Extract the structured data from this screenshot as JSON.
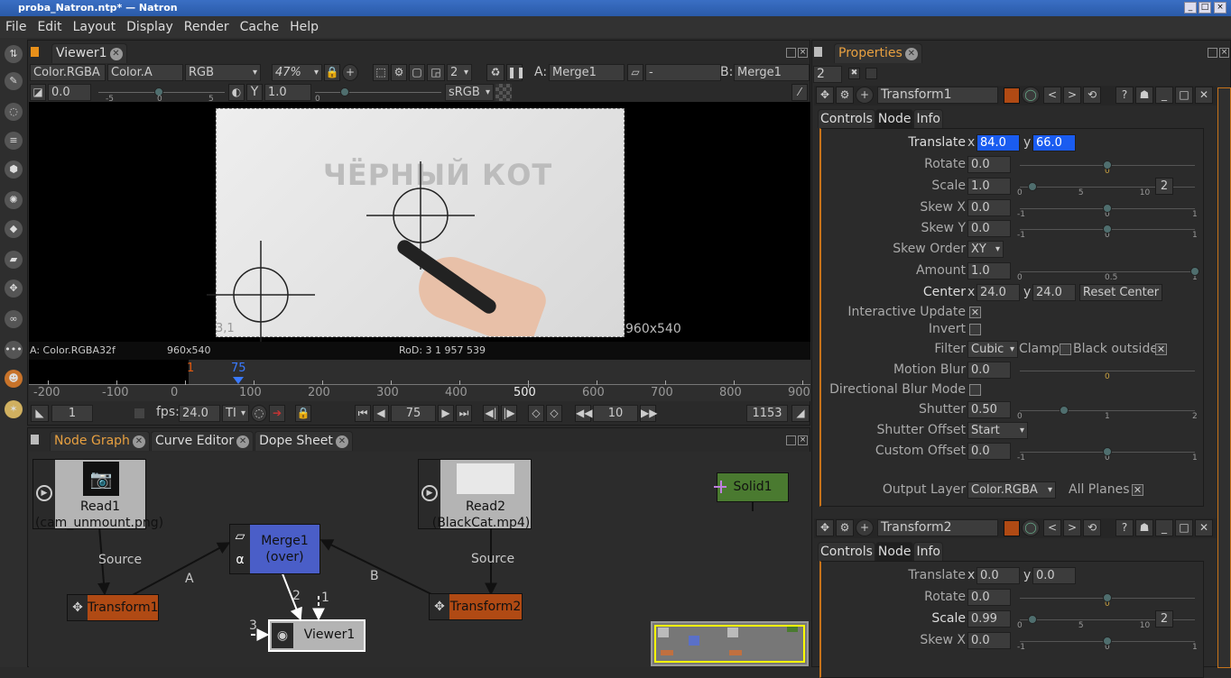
{
  "window": {
    "title": "proba_Natron.ntp* — Natron"
  },
  "menu": [
    "File",
    "Edit",
    "Layout",
    "Display",
    "Render",
    "Cache",
    "Help"
  ],
  "viewer": {
    "tab": "Viewer1",
    "layer": "Color.RGBA",
    "alpha": "Color.A",
    "channels": "RGB",
    "zoom": "47%",
    "frame_layout": "2",
    "input_a_label": "A:",
    "input_a": "Merge1",
    "composite": "-",
    "input_b_label": "B:",
    "input_b": "Merge1",
    "gain": "0.0",
    "gain_ticks": [
      "-5",
      "0",
      "5"
    ],
    "gamma_label": "Y",
    "gamma": "1.0",
    "gamma_tick": "0",
    "colorspace": "sRGB",
    "image_overlay_text": "ЧЁРНЫЙ КОТ",
    "bottom_left_coord": "3,1",
    "format_label": "960x540",
    "info": {
      "layer": "A: Color.RGBA32f",
      "format": "960x540",
      "rod": "RoD: 3 1 957 539"
    }
  },
  "timeline": {
    "ticks": [
      "-200",
      "-100",
      "0",
      "100",
      "200",
      "300",
      "400",
      "500",
      "600",
      "700",
      "800",
      "900"
    ],
    "in_marker": "1",
    "current_marker": "75",
    "start_frame": "1",
    "fps_label": "fps:",
    "fps": "24.0",
    "tl_mode": "TI",
    "current_frame": "75",
    "increment": "10",
    "end_frame": "1153"
  },
  "nodegraph": {
    "tabs": [
      "Node Graph",
      "Curve Editor",
      "Dope Sheet"
    ],
    "nodes": {
      "read1": "Read1",
      "read1_file": "(cam_unmount.png)",
      "read2": "Read2",
      "read2_file": "(BlackCat.mp4)",
      "merge": "Merge1",
      "merge_op": "(over)",
      "transform1": "Transform1",
      "transform2": "Transform2",
      "viewer": "Viewer1",
      "solid": "Solid1"
    },
    "edge_labels": {
      "source1": "Source",
      "source2": "Source",
      "a": "A",
      "b": "B",
      "in1": "1",
      "in2": "2",
      "in3": "3"
    },
    "colors": {
      "transform": "#b04a14",
      "merge": "#4a5ec8",
      "read": "#b4b4b4",
      "solid": "#4a7a30"
    }
  },
  "properties": {
    "tab": "Properties",
    "max_panels": "2",
    "panel1": {
      "name": "Transform1",
      "color": "#b04a14",
      "tabs": [
        "Controls",
        "Node",
        "Info"
      ],
      "rows": [
        {
          "label": "Translate",
          "type": "xy",
          "x": "84.0",
          "y": "66.0",
          "highlight": true
        },
        {
          "label": "Rotate",
          "type": "slider",
          "value": "0.0",
          "ticks": [
            "0"
          ],
          "knob": 0.5
        },
        {
          "label": "Scale",
          "type": "slider",
          "value": "1.0",
          "ticks": [
            "0",
            "5",
            "10"
          ],
          "knob": 0.1,
          "extra": "2"
        },
        {
          "label": "Skew X",
          "type": "slider",
          "value": "0.0",
          "ticks": [
            "-1",
            "0",
            "1"
          ],
          "knob": 0.5
        },
        {
          "label": "Skew Y",
          "type": "slider",
          "value": "0.0",
          "ticks": [
            "-1",
            "0",
            "1"
          ],
          "knob": 0.5
        },
        {
          "label": "Skew Order",
          "type": "choice",
          "value": "XY"
        },
        {
          "label": "Amount",
          "type": "slider",
          "value": "1.0",
          "ticks": [
            "0",
            "0.5",
            "1"
          ],
          "knob": 1
        },
        {
          "label": "Center",
          "type": "center",
          "x": "24.0",
          "y": "24.0",
          "button": "Reset Center"
        },
        {
          "label": "Interactive Update",
          "type": "check",
          "checked": true
        },
        {
          "label": "Invert",
          "type": "check",
          "checked": false
        },
        {
          "label": "Filter",
          "type": "filter",
          "value": "Cubic",
          "clamp": "Clamp",
          "black": "Black outside"
        },
        {
          "label": "Motion Blur",
          "type": "slider",
          "value": "0.0",
          "ticks": [
            "0"
          ],
          "knob": -1
        },
        {
          "label": "Directional Blur Mode",
          "type": "check",
          "checked": false
        },
        {
          "label": "Shutter",
          "type": "slider",
          "value": "0.50",
          "ticks": [
            "0",
            "1",
            "2"
          ],
          "knob": 0.25
        },
        {
          "label": "Shutter Offset",
          "type": "choice",
          "value": "Start"
        },
        {
          "label": "Custom Offset",
          "type": "slider",
          "value": "0.0",
          "ticks": [
            "-1",
            "0",
            "1"
          ],
          "knob": 0.5
        }
      ],
      "output_layer_label": "Output Layer",
      "output_layer": "Color.RGBA",
      "all_planes": "All Planes"
    },
    "panel2": {
      "name": "Transform2",
      "tabs": [
        "Controls",
        "Node",
        "Info"
      ],
      "rows": [
        {
          "label": "Translate",
          "type": "xy",
          "x": "0.0",
          "y": "0.0"
        },
        {
          "label": "Rotate",
          "type": "slider",
          "value": "0.0",
          "ticks": [
            "0"
          ],
          "knob": 0.5
        },
        {
          "label": "Scale",
          "type": "slider",
          "value": "0.99",
          "ticks": [
            "0",
            "5",
            "10"
          ],
          "knob": 0.1,
          "extra": "2",
          "on": true
        },
        {
          "label": "Skew X",
          "type": "slider",
          "value": "0.0",
          "ticks": [
            "-1",
            "0",
            "1"
          ],
          "knob": 0.5
        }
      ]
    }
  }
}
